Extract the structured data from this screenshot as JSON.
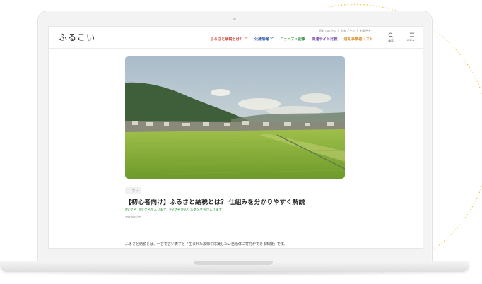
{
  "site": {
    "logo": "ふるこい",
    "util_links": [
      "初めての方へ",
      "料金プラン",
      "お問合せ"
    ],
    "nav": [
      {
        "label": "ふるさと納税とは？ ﹀",
        "color": "#c8473b"
      },
      {
        "label": "公募情報 ﹀",
        "color": "#2d5aa6"
      },
      {
        "label": "ニュース・記事",
        "color": "#2e8b3a"
      },
      {
        "label": "関連サイト比較",
        "color": "#7a4bb0"
      },
      {
        "label": "返礼事業者リスト",
        "color": "#d28a1f"
      }
    ],
    "search_label": "検索",
    "menu_label": "メニュー"
  },
  "article": {
    "category": "コラム",
    "title": "【初心者向け】ふるさと納税とは？ 仕組みを分かりやすく解説",
    "tags": [
      "#タグ名",
      "#タグ名が入ります",
      "#タグ名が入りますタグ名が入ります"
    ],
    "date": "2023/07/20",
    "body_excerpt": "ふるさと納税とは、一言で言い表すと『生まれた故郷や応援したい自治体に寄付ができる制度』です。"
  },
  "icons": {
    "search": "search-icon",
    "menu": "hamburger-menu-icon"
  }
}
